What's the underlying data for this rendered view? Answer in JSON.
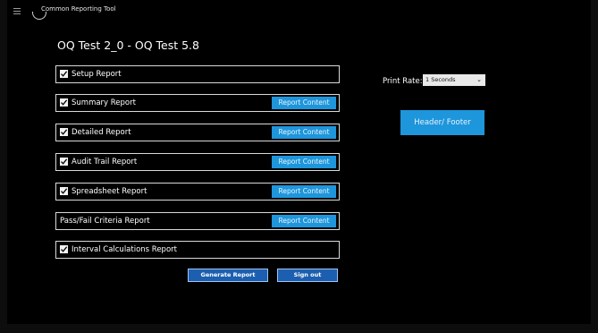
{
  "app": {
    "title": "Common Reporting Tool"
  },
  "page": {
    "title": "OQ Test 2_0 - OQ Test 5.8"
  },
  "reports": [
    {
      "label": "Setup Report",
      "checked": true,
      "button": ""
    },
    {
      "label": "Summary Report",
      "checked": true,
      "button": "Report Content"
    },
    {
      "label": "Detailed Report",
      "checked": true,
      "button": "Report Content"
    },
    {
      "label": "Audit Trail Report",
      "checked": true,
      "button": "Report Content"
    },
    {
      "label": "Spreadsheet Report",
      "checked": true,
      "button": "Report Content"
    },
    {
      "label": "Pass/Fail Criteria Report",
      "checked": false,
      "button": "Report Content"
    },
    {
      "label": "Interval Calculations Report",
      "checked": true,
      "button": ""
    }
  ],
  "print_rate": {
    "label": "Print Rate:",
    "selected": "1 Seconds"
  },
  "header_footer_button": "Header/ Footer",
  "actions": {
    "generate": "Generate Report",
    "sign_out": "Sign out"
  },
  "colors": {
    "accent": "#1e96dc",
    "action_button": "#1c5fb0",
    "background": "#000000"
  },
  "icons": {
    "menu": "hamburger-icon",
    "back": "back-arc-icon",
    "checkbox": "checkbox-checked-icon",
    "dropdown": "chevron-down-icon"
  }
}
